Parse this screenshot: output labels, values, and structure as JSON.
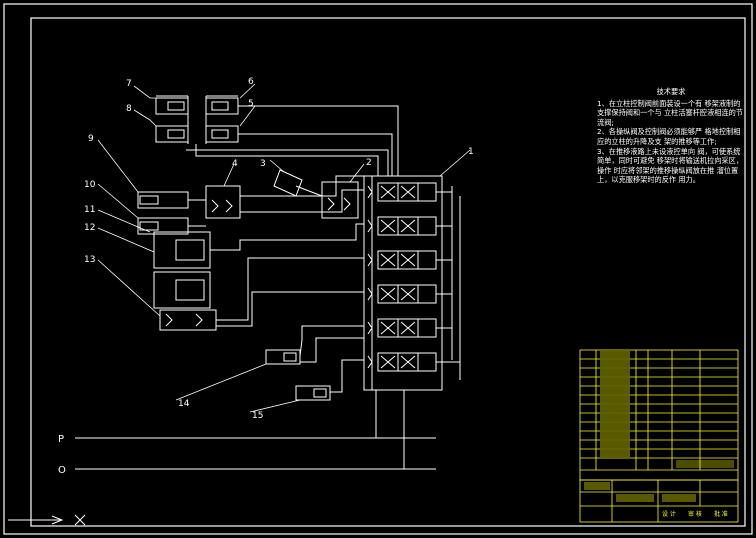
{
  "notes": {
    "title": "技术要求",
    "items": [
      "1、在立柱控制阀前面装设一个有 移架液制的支撑保持阀和一个与 立柱活塞杆腔液相连的节流阀;",
      "2、各操纵阀及控制阀必须能够严 格地控制相应的立柱的升降及支 架的推移等工作;",
      "3、在推移液路上未设液控单向 阀，可使系统简单，同时可避免 移架时将输送机拉向采区，操作 时应将邻架的推移操纵阀放在推 溜位置上，以克服移架时的反作 用力。"
    ]
  },
  "part_labels": [
    "1",
    "2",
    "3",
    "4",
    "5",
    "6",
    "7",
    "8",
    "9",
    "10",
    "11",
    "12",
    "13",
    "14",
    "15"
  ],
  "bus_labels": {
    "pressure": "P",
    "return": "O"
  },
  "title_block": {
    "bottom_row": [
      "设 计",
      "审 核",
      "批 准"
    ]
  },
  "colors": {
    "background": "#000000",
    "lines": "#ffffff",
    "title_block": "#ffff00"
  }
}
